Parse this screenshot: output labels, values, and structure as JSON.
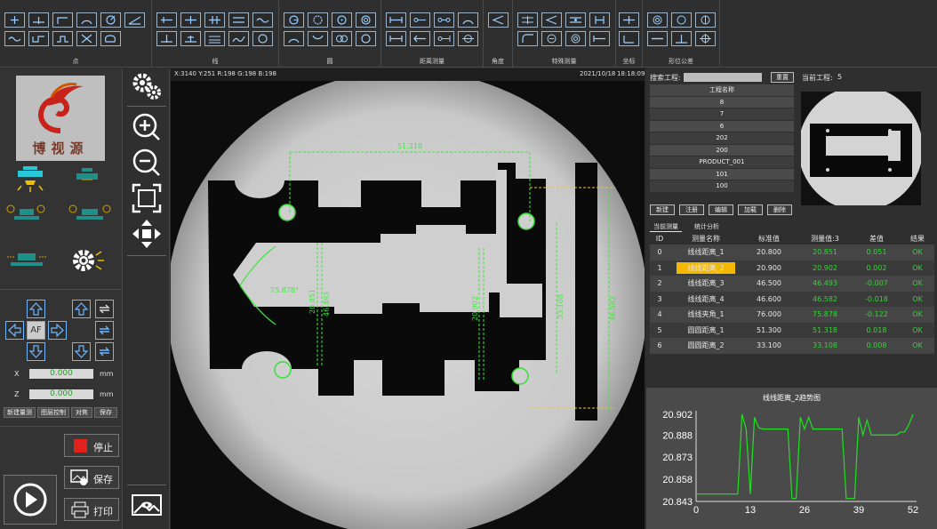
{
  "toolbar": {
    "groups": [
      {
        "label": "点"
      },
      {
        "label": "线"
      },
      {
        "label": "圆"
      },
      {
        "label": "距离测量"
      },
      {
        "label": "角度"
      },
      {
        "label": "特殊测量"
      },
      {
        "label": "坐标"
      },
      {
        "label": "形位公差"
      }
    ]
  },
  "left": {
    "logo_text": "博视源",
    "axes": {
      "x_label": "X",
      "x_value": "0.000",
      "x_unit": "mm",
      "z_label": "Z",
      "z_value": "0.000",
      "z_unit": "mm",
      "af_label": "AF"
    },
    "mini_buttons": [
      "新建量测",
      "图层控制",
      "对焦",
      "保存"
    ],
    "stop_label": "停止",
    "save_label": "保存",
    "print_label": "打印"
  },
  "viewport": {
    "coord_readout": "X:3140   Y:251    R:198  G:198  B:198",
    "date": "2021/10/18",
    "time": "18:18:09",
    "annotations": {
      "top_distance": "51.318",
      "angle": "75.878°",
      "d1": "20.851",
      "d2": "46.493",
      "d3": "20.902",
      "d4": "33.108",
      "d5": "46.582"
    }
  },
  "right": {
    "search_label": "搜索工程:",
    "reset_label": "重置",
    "current_project_label": "当前工程:",
    "current_project_value": "5",
    "project_header": "工程名称",
    "projects": [
      "8",
      "7",
      "6",
      "202",
      "200",
      "PRODUCT_001",
      "101",
      "100"
    ],
    "project_buttons": [
      "新建",
      "注册",
      "编辑",
      "加载",
      "删除"
    ],
    "tabs": [
      "当前测量",
      "统计分析"
    ],
    "meas_headers": [
      "ID",
      "测量名称",
      "标准值",
      "测量值:3",
      "差值",
      "结果"
    ],
    "measurements": [
      {
        "id": "0",
        "name": "线线距离_1",
        "std": "20.800",
        "val": "20.851",
        "diff": "0.051",
        "res": "OK"
      },
      {
        "id": "1",
        "name": "线线距离_2",
        "std": "20.900",
        "val": "20.902",
        "diff": "0.002",
        "res": "OK"
      },
      {
        "id": "2",
        "name": "线线距离_3",
        "std": "46.500",
        "val": "46.493",
        "diff": "-0.007",
        "res": "OK"
      },
      {
        "id": "3",
        "name": "线线距离_4",
        "std": "46.600",
        "val": "46.582",
        "diff": "-0.018",
        "res": "OK"
      },
      {
        "id": "4",
        "name": "线线夹角_1",
        "std": "76.000",
        "val": "75.878",
        "diff": "-0.122",
        "res": "OK"
      },
      {
        "id": "5",
        "name": "圆圆距离_1",
        "std": "51.300",
        "val": "51.318",
        "diff": "0.018",
        "res": "OK"
      },
      {
        "id": "6",
        "name": "圆圆距离_2",
        "std": "33.100",
        "val": "33.108",
        "diff": "0.008",
        "res": "OK"
      }
    ],
    "selected_row": 1,
    "colors": {
      "selected_bg": "#f5b800",
      "ok_green": "#33d633",
      "trend_line": "#22e022"
    }
  },
  "chart_data": {
    "type": "line",
    "title": "线线距离_2趋势图",
    "x_ticks": [
      0,
      13,
      26,
      39,
      52
    ],
    "y_ticks": [
      20.843,
      20.858,
      20.873,
      20.888,
      20.902
    ],
    "ylim": [
      20.843,
      20.902
    ],
    "xlim": [
      0,
      52
    ],
    "series": [
      {
        "values": [
          20.848,
          20.848,
          20.848,
          20.848,
          20.848,
          20.848,
          20.848,
          20.848,
          20.848,
          20.848,
          20.848,
          20.902,
          20.892,
          20.848,
          20.9,
          20.893,
          20.892,
          20.892,
          20.892,
          20.892,
          20.892,
          20.892,
          20.892,
          20.845,
          20.845,
          20.9,
          20.892,
          20.9,
          20.892,
          20.892,
          20.892,
          20.892,
          20.892,
          20.892,
          20.892,
          20.892,
          20.845,
          20.845,
          20.845,
          20.9,
          20.888,
          20.898,
          20.888,
          20.888,
          20.888,
          20.888,
          20.888,
          20.888,
          20.888,
          20.89,
          20.89,
          20.895,
          20.902
        ]
      }
    ]
  }
}
